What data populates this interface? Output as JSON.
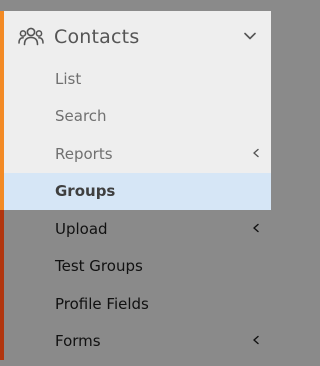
{
  "menu": {
    "title": "Contacts",
    "header_icon": "users-icon",
    "header_chevron_icon": "chevron-down-icon",
    "items": [
      {
        "label": "List",
        "has_submenu": false,
        "selected": false
      },
      {
        "label": "Search",
        "has_submenu": false,
        "selected": false
      },
      {
        "label": "Reports",
        "has_submenu": true,
        "selected": false
      },
      {
        "label": "Groups",
        "has_submenu": false,
        "selected": true
      },
      {
        "label": "Upload",
        "has_submenu": true,
        "selected": false
      },
      {
        "label": "Test Groups",
        "has_submenu": false,
        "selected": false
      },
      {
        "label": "Profile Fields",
        "has_submenu": false,
        "selected": false
      },
      {
        "label": "Forms",
        "has_submenu": true,
        "selected": false
      }
    ],
    "submenu_icon": "chevron-left-icon"
  },
  "colors": {
    "light_panel": "#eeeeee",
    "dark_panel": "#8a8a8a",
    "accent_top": "#f38a24",
    "accent_bottom": "#b2360f",
    "selected_bg": "#d6e6f6"
  }
}
